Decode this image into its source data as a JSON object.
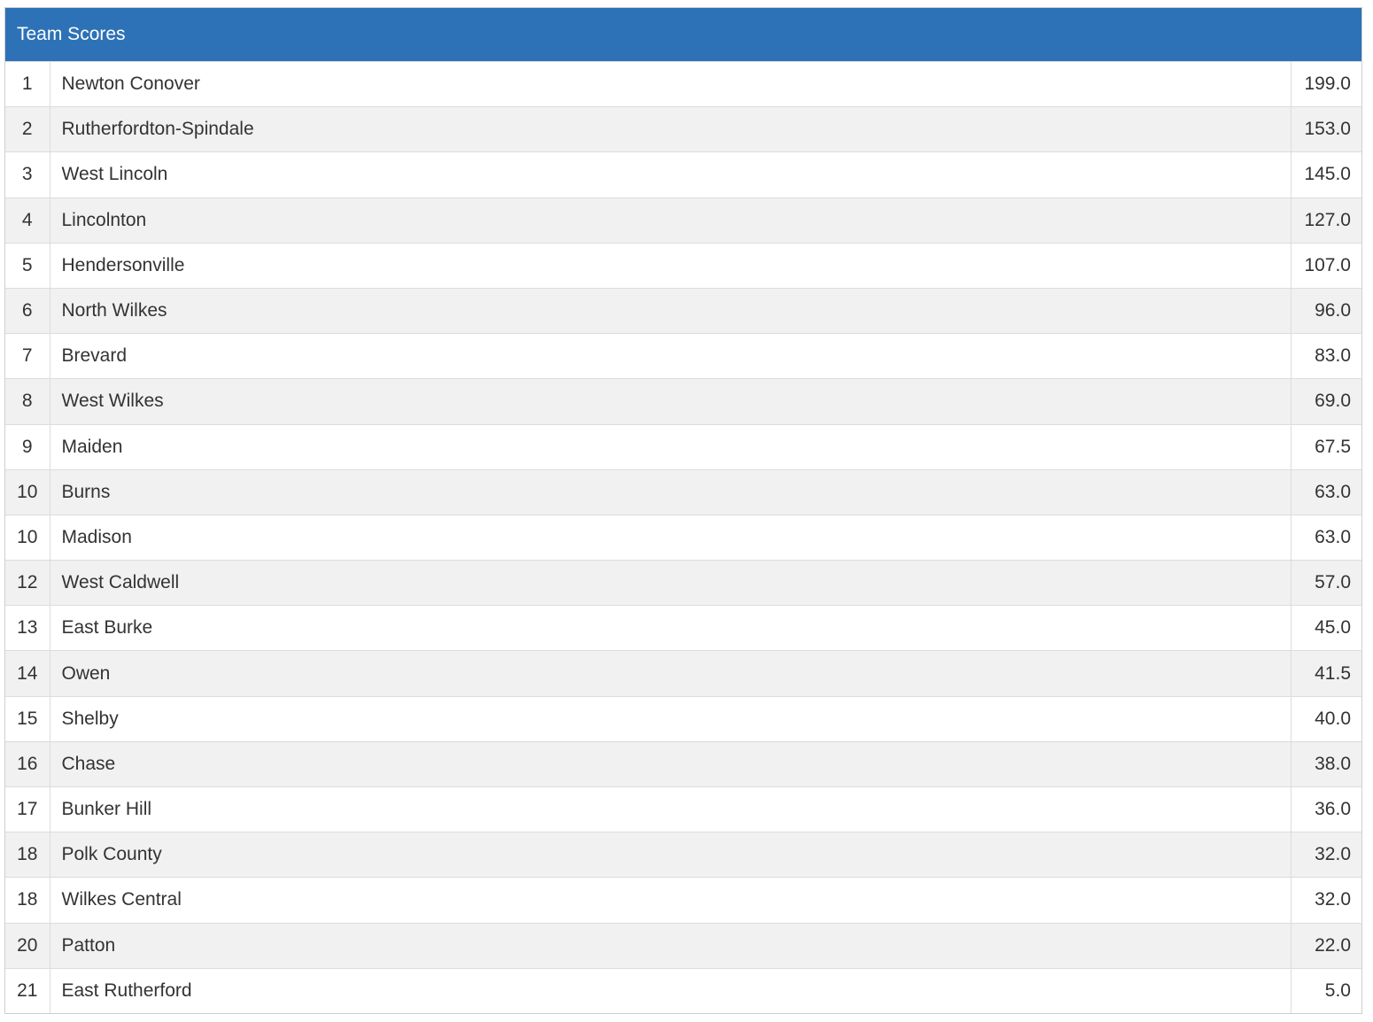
{
  "panel": {
    "title": "Team Scores"
  },
  "colors": {
    "header_bg": "#2d72b6",
    "row_alt_bg": "#f1f1f1"
  },
  "rows": [
    {
      "rank": "1",
      "team": "Newton Conover",
      "score": "199.0"
    },
    {
      "rank": "2",
      "team": "Rutherfordton-Spindale",
      "score": "153.0"
    },
    {
      "rank": "3",
      "team": "West Lincoln",
      "score": "145.0"
    },
    {
      "rank": "4",
      "team": "Lincolnton",
      "score": "127.0"
    },
    {
      "rank": "5",
      "team": "Hendersonville",
      "score": "107.0"
    },
    {
      "rank": "6",
      "team": "North Wilkes",
      "score": "96.0"
    },
    {
      "rank": "7",
      "team": "Brevard",
      "score": "83.0"
    },
    {
      "rank": "8",
      "team": "West Wilkes",
      "score": "69.0"
    },
    {
      "rank": "9",
      "team": "Maiden",
      "score": "67.5"
    },
    {
      "rank": "10",
      "team": "Burns",
      "score": "63.0"
    },
    {
      "rank": "10",
      "team": "Madison",
      "score": "63.0"
    },
    {
      "rank": "12",
      "team": "West Caldwell",
      "score": "57.0"
    },
    {
      "rank": "13",
      "team": "East Burke",
      "score": "45.0"
    },
    {
      "rank": "14",
      "team": "Owen",
      "score": "41.5"
    },
    {
      "rank": "15",
      "team": "Shelby",
      "score": "40.0"
    },
    {
      "rank": "16",
      "team": "Chase",
      "score": "38.0"
    },
    {
      "rank": "17",
      "team": "Bunker Hill",
      "score": "36.0"
    },
    {
      "rank": "18",
      "team": "Polk County",
      "score": "32.0"
    },
    {
      "rank": "18",
      "team": "Wilkes Central",
      "score": "32.0"
    },
    {
      "rank": "20",
      "team": "Patton",
      "score": "22.0"
    },
    {
      "rank": "21",
      "team": "East Rutherford",
      "score": "5.0"
    }
  ]
}
